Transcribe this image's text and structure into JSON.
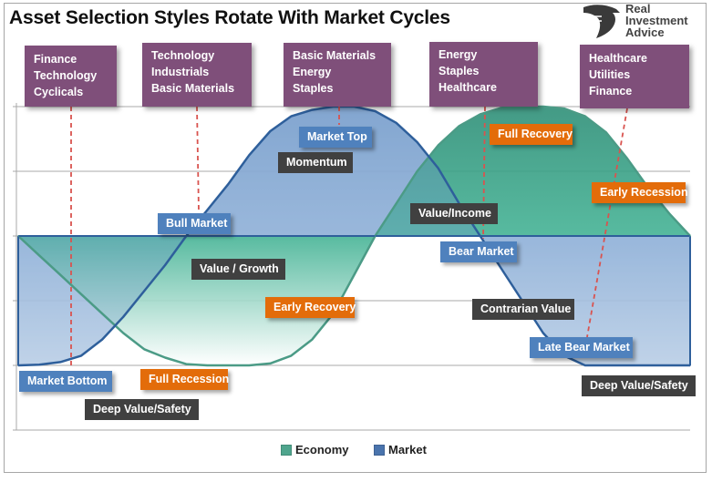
{
  "title": "Asset Selection Styles Rotate With Market Cycles",
  "logo": {
    "icon": "eagle-head-icon",
    "lines": [
      "Real",
      "Investment",
      "Advice"
    ]
  },
  "colors": {
    "market_fill": "#8eaed4",
    "market_line": "#2e5f9b",
    "economy_fill": "#3fa58a",
    "economy_line": "#4b9b86",
    "sector_box": "#7f4f7a",
    "blue_label": "#4f81bd",
    "orange_label": "#e36c0a",
    "dark_label": "#404040",
    "dashed_line": "#d9534f"
  },
  "sectors": [
    {
      "lines": [
        "Finance",
        "Technology",
        "Cyclicals"
      ]
    },
    {
      "lines": [
        "Technology",
        "Industrials",
        "Basic Materials"
      ]
    },
    {
      "lines": [
        "Basic Materials",
        "Energy",
        "Staples"
      ]
    },
    {
      "lines": [
        "Energy",
        "Staples",
        "Healthcare"
      ]
    },
    {
      "lines": [
        "Healthcare",
        "Utilities",
        "Finance"
      ]
    }
  ],
  "market_phase_labels": [
    "Market Bottom",
    "Bull Market",
    "Market Top",
    "Bear Market",
    "Late Bear Market"
  ],
  "economy_phase_labels": [
    "Full Recession",
    "Early Recovery",
    "Full Recovery",
    "Early Recession"
  ],
  "style_labels": [
    "Deep Value/Safety",
    "Value / Growth",
    "Momentum",
    "Value/Income",
    "Contrarian Value",
    "Deep Value/Safety"
  ],
  "chart_data": {
    "type": "area",
    "title": "Asset Selection Styles Rotate With Market Cycles",
    "xlabel": "",
    "ylabel": "",
    "ylim": [
      -2,
      2
    ],
    "grid": true,
    "legend_position": "bottom-center",
    "x": [
      0,
      1,
      2,
      3,
      4,
      5,
      6,
      7,
      8,
      9,
      10,
      11,
      12,
      13,
      14,
      15,
      16,
      17,
      18,
      19,
      20,
      21,
      22,
      23,
      24,
      25,
      26,
      27,
      28,
      29,
      30,
      31,
      32
    ],
    "series": [
      {
        "name": "Economy",
        "values": [
          0.0,
          -0.3,
          -0.6,
          -0.9,
          -1.2,
          -1.5,
          -1.75,
          -1.88,
          -1.98,
          -2.0,
          -2.0,
          -2.0,
          -1.97,
          -1.85,
          -1.6,
          -1.2,
          -0.6,
          0.0,
          0.5,
          1.0,
          1.4,
          1.7,
          1.88,
          1.98,
          2.0,
          2.0,
          1.97,
          1.85,
          1.6,
          1.2,
          0.75,
          0.35,
          0.0
        ]
      },
      {
        "name": "Market",
        "values": [
          -2.0,
          -1.99,
          -1.95,
          -1.85,
          -1.6,
          -1.25,
          -0.85,
          -0.45,
          0.0,
          0.4,
          0.8,
          1.25,
          1.62,
          1.85,
          1.95,
          2.0,
          2.0,
          1.93,
          1.75,
          1.45,
          1.05,
          0.5,
          0.0,
          -0.5,
          -1.0,
          -1.5,
          -1.85,
          -2.0,
          -2.0,
          -2.0,
          -2.0,
          -2.0,
          -2.0
        ]
      }
    ],
    "legend": [
      "Economy",
      "Market"
    ],
    "annotations": {
      "sector_rotation": [
        "Finance, Technology, Cyclicals",
        "Technology, Industrials, Basic Materials",
        "Basic Materials, Energy, Staples",
        "Energy, Staples, Healthcare",
        "Healthcare, Utilities, Finance"
      ],
      "market_phases": [
        "Market Bottom",
        "Bull Market",
        "Market Top",
        "Bear Market",
        "Late Bear Market"
      ],
      "economy_phases": [
        "Full Recession",
        "Early Recovery",
        "Full Recovery",
        "Early Recession"
      ],
      "styles": [
        "Deep Value/Safety",
        "Value / Growth",
        "Momentum",
        "Value/Income",
        "Contrarian Value",
        "Deep Value/Safety"
      ]
    }
  }
}
